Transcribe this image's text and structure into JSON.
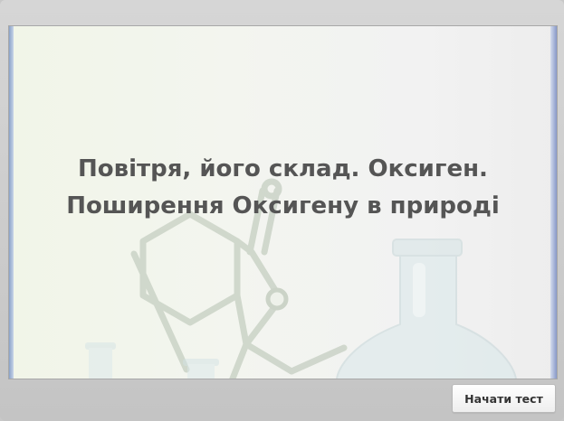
{
  "slide": {
    "title_line1": "Повітря, його склад. Оксиген.",
    "title_line2": "Поширення Оксигену в природі"
  },
  "footer": {
    "start_button_label": "Начати тест"
  },
  "colors": {
    "title_text": "#555555",
    "slide_edge_accent": "#8aa2c8"
  }
}
